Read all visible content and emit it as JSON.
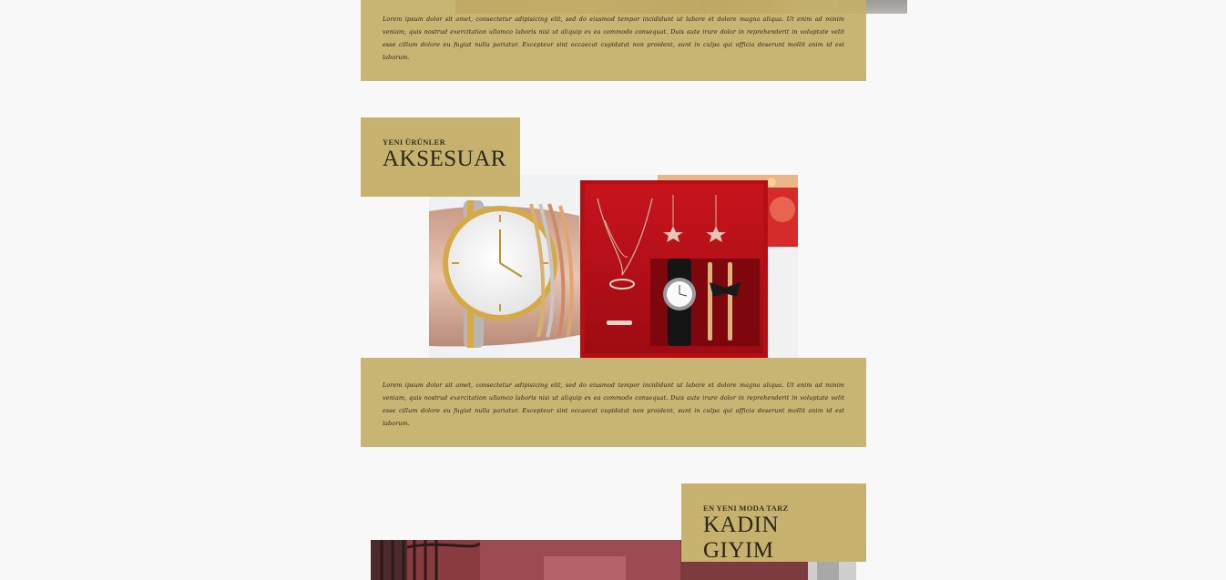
{
  "sections": [
    {
      "description": "Lorem ipsum dolor sit amet, consectetur adipisicing elit, sed do eiusmod tempor incididunt ut labore et dolore magna aliqua. Ut enim ad minim veniam, quis nostrud exercitation ullamco laboris nisi ut aliquip ex ea commodo consequat. Duis aute irure dolor in reprehenderit in voluptate velit esse cillum dolore eu fugiat nulla pariatur. Excepteur sint occaecat cupidatat non proident, sunt in culpa qui officia deserunt mollit anim id est laborum."
    },
    {
      "eyebrow": "YENI ÜRÜNLER",
      "title": "AKSESUAR",
      "description": "Lorem ipsum dolor sit amet, consectetur adipisicing elit, sed do eiusmod tempor incididunt ut labore et dolore magna aliqua. Ut enim ad minim veniam, quis nostrud exercitation ullamco laboris nisi ut aliquip ex ea commodo consequat. Duis aute irure dolor in reprehenderit in voluptate velit esse cillum dolore eu fugiat nulla pariatur. Excepteur sint occaecat cupidatat non proident, sunt in culpa qui officia deserunt mollit anim id est laborum.",
      "image_icon": "watch-jewelry-gift-set-photo"
    },
    {
      "eyebrow": "EN YENI MODA TARZ",
      "title": "KADIN GIYIM",
      "image_icon": "street-fashion-photo"
    }
  ],
  "colors": {
    "background": "#f8f8f8",
    "label_box": "#c6b26e",
    "description_box": "#c4ae68",
    "text_dark": "#2b2718"
  }
}
